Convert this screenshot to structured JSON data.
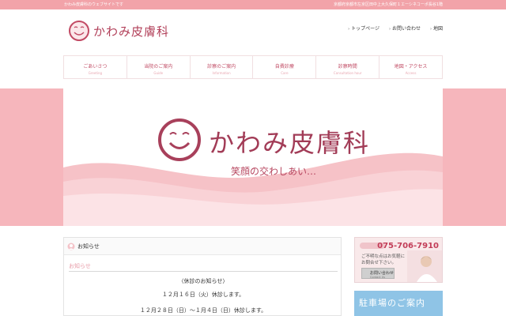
{
  "topbar": {
    "tagline": "かわみ皮膚科のウェブサイトです",
    "address": "京都府京都市左京区田中上大久保町１エーシネコーポ長谷1階"
  },
  "logo": {
    "text": "かわみ皮膚科"
  },
  "util_nav": [
    {
      "label": "トップページ"
    },
    {
      "label": "お問い合わせ"
    },
    {
      "label": "地図"
    }
  ],
  "global_nav": [
    {
      "jp": "ごあいさつ",
      "en": "Greeting"
    },
    {
      "jp": "当院のご案内",
      "en": "Guide"
    },
    {
      "jp": "診察のご案内",
      "en": "Information"
    },
    {
      "jp": "自費診療",
      "en": "Care"
    },
    {
      "jp": "診察時間",
      "en": "Consultation hour"
    },
    {
      "jp": "地図・アクセス",
      "en": "Access"
    }
  ],
  "hero": {
    "title": "かわみ皮膚科",
    "subtitle": "笑顔の交わしあい…"
  },
  "news": {
    "heading": "お知らせ",
    "subheading": "お知らせ",
    "lines": [
      "〈休診のお知らせ〉",
      "１２月１６日（火）休診します。",
      "１２月２８日（日）〜１月４日（日）休診します。"
    ]
  },
  "contact_banner": {
    "tel": "075-706-7910",
    "text_line1": "ご不明な点はお気軽に",
    "text_line2": "お問合せ下さい。",
    "button_label": "お問い合わせ",
    "button_en": "Contact Us"
  },
  "parking_banner": {
    "label": "駐車場のご案内"
  },
  "colors": {
    "brand": "#b2405a",
    "topbar": "#f2a3a9",
    "hero_band": "#f6b6bc",
    "parking": "#8fc4e6"
  }
}
